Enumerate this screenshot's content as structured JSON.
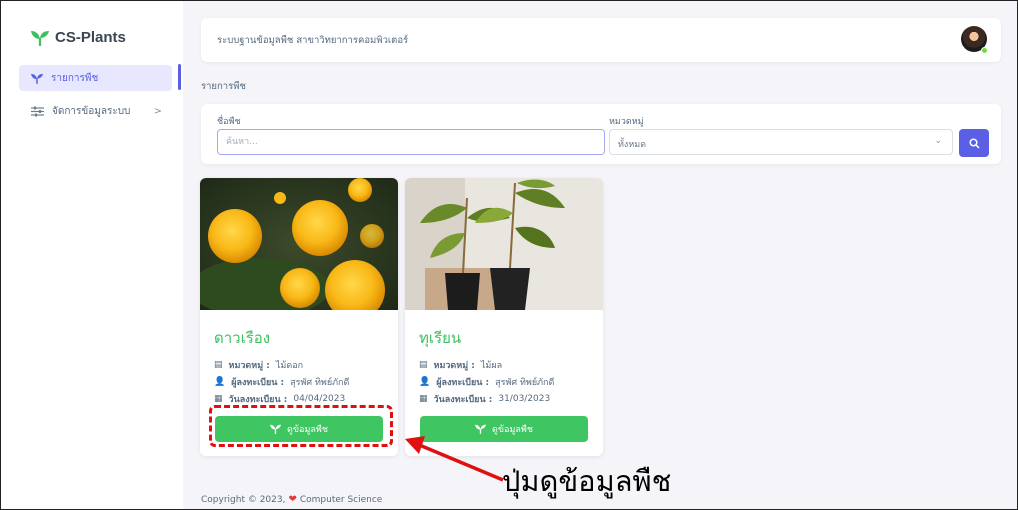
{
  "brand": {
    "name": "CS-Plants",
    "color": "#3fbf60"
  },
  "sidebar": {
    "items": [
      {
        "label": "รายการพืช",
        "icon": "sprout-icon",
        "active": true
      },
      {
        "label": "จัดการข้อมูลระบบ",
        "icon": "sliders-icon",
        "chevron": ">"
      }
    ]
  },
  "topbar": {
    "title": "ระบบฐานข้อมูลพืช สาขาวิทยาการคอมพิวเตอร์"
  },
  "breadcrumb": "รายการพืช",
  "filter": {
    "name_label": "ชื่อพืช",
    "name_placeholder": "ค้นหา...",
    "category_label": "หมวดหมู่",
    "category_value": "ทั้งหมด"
  },
  "cards": [
    {
      "title": "ดาวเรือง",
      "category_label": "หมวดหมู่ :",
      "category_value": "ไม้ดอก",
      "registrar_label": "ผู้ลงทะเบียน :",
      "registrar_value": "สุรพัศ ทิพย์ภักดี",
      "date_label": "วันลงทะเบียน :",
      "date_value": "04/04/2023",
      "button": "ดูข้อมูลพืช"
    },
    {
      "title": "ทุเรียน",
      "category_label": "หมวดหมู่ :",
      "category_value": "ไม้ผล",
      "registrar_label": "ผู้ลงทะเบียน :",
      "registrar_value": "สุรพัศ ทิพย์ภักดี",
      "date_label": "วันลงทะเบียน :",
      "date_value": "31/03/2023",
      "button": "ดูข้อมูลพืช"
    }
  ],
  "footer": {
    "text": "Copyright © 2023,",
    "suffix": "Computer Science"
  },
  "annotation": {
    "text": "ปุ่มดูข้อมูลพืช",
    "color": "#e01010"
  },
  "colors": {
    "primary": "#5b5fe6",
    "green": "#3fc562",
    "bg": "#f5f5f9"
  }
}
